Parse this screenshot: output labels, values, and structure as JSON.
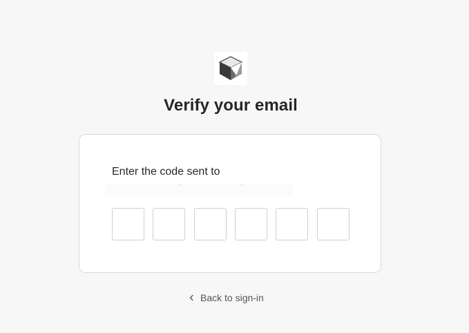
{
  "logo": {
    "icon": "cube-logo-icon",
    "colors": {
      "dark": "#2e2e2e",
      "mid": "#6b6b6b",
      "light": "#b4b4b4"
    }
  },
  "header": {
    "title": "Verify your email"
  },
  "card": {
    "prompt": "Enter the code sent to",
    "otp": {
      "digits": [
        "",
        "",
        "",
        "",
        "",
        ""
      ]
    }
  },
  "footer": {
    "back_label": "Back to sign-in",
    "back_icon": "chevron-left-icon"
  },
  "colors": {
    "background": "#f7f7f7",
    "card_border": "#d9d9d9",
    "input_border": "#cfcfcf",
    "text": "#262626",
    "link": "#555555"
  }
}
